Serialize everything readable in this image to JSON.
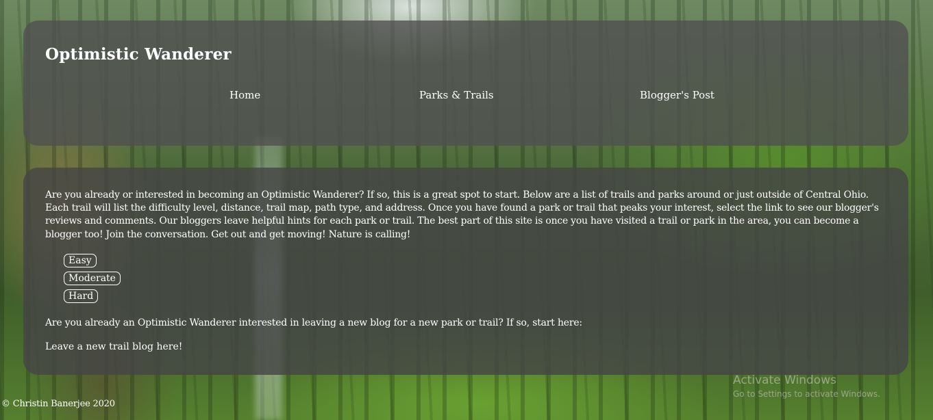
{
  "header": {
    "site_title": "Optimistic Wanderer",
    "nav": [
      {
        "label": "Home"
      },
      {
        "label": "Parks & Trails"
      },
      {
        "label": "Blogger's Post"
      }
    ]
  },
  "main": {
    "intro": "Are you already or interested in becoming an Optimistic Wanderer? If so, this is a great spot to start. Below are a list of trails and parks around or just outside of Central Ohio. Each trail will list the difficulty level, distance, trail map, path type, and address. Once you have found a park or trail that peaks your interest, select the link to see our blogger's reviews and comments. Our bloggers leave helpful hints for each park or trail. The best part of this site is once you have visited a trail or park in the area, you can become a blogger too! Join the conversation. Get out and get moving! Nature is calling!",
    "difficulty_levels": [
      {
        "label": "Easy"
      },
      {
        "label": "Moderate"
      },
      {
        "label": "Hard"
      }
    ],
    "blog_question": "Are you already an Optimistic Wanderer interested in leaving a new blog for a new park or trail? If so, start here:",
    "blog_link": "Leave a new trail blog here!"
  },
  "footer": {
    "copyright": "© Christin Banerjee 2020"
  },
  "watermark": {
    "title": "Activate Windows",
    "subtitle": "Go to Settings to activate Windows."
  }
}
